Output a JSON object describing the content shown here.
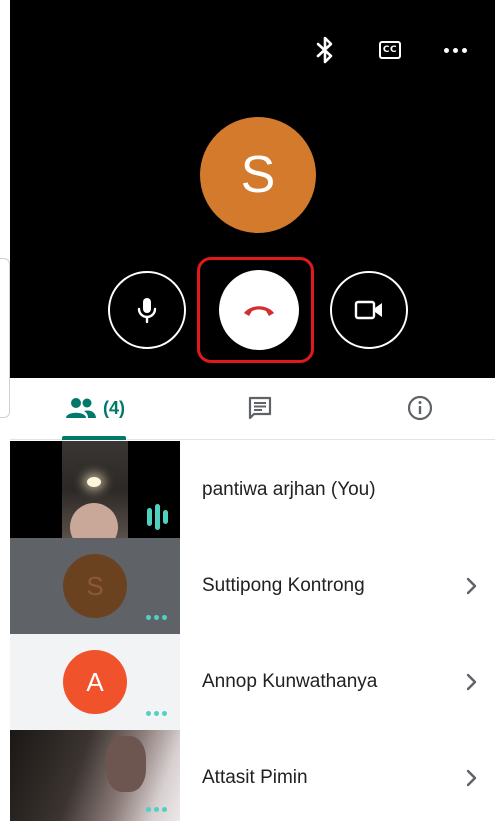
{
  "call": {
    "avatar_letter": "S",
    "caption_icon_label": "CC",
    "accent_end_call": "#d32f2f",
    "highlight_color": "#e01a1a"
  },
  "icons": {
    "bluetooth": "bluetooth-icon",
    "captions": "closed-captions-icon",
    "more": "more-horizontal-icon",
    "mic": "microphone-icon",
    "end_call": "end-call-icon",
    "camera": "video-camera-icon",
    "people": "people-icon",
    "chat": "chat-icon",
    "info": "info-icon"
  },
  "tabs": {
    "people_count": "(4)"
  },
  "participants": [
    {
      "name": "pantiwa arjhan (You)",
      "speaking": true
    },
    {
      "name": "Suttipong Kontrong",
      "avatar_letter": "S",
      "avatar_color": "#6b4220"
    },
    {
      "name": "Annop Kunwathanya",
      "avatar_letter": "A",
      "avatar_color": "#f0522c"
    },
    {
      "name": "Attasit Pimin"
    }
  ],
  "colors": {
    "accent": "#00796b",
    "speaking_indicator": "#4fd1c0"
  }
}
